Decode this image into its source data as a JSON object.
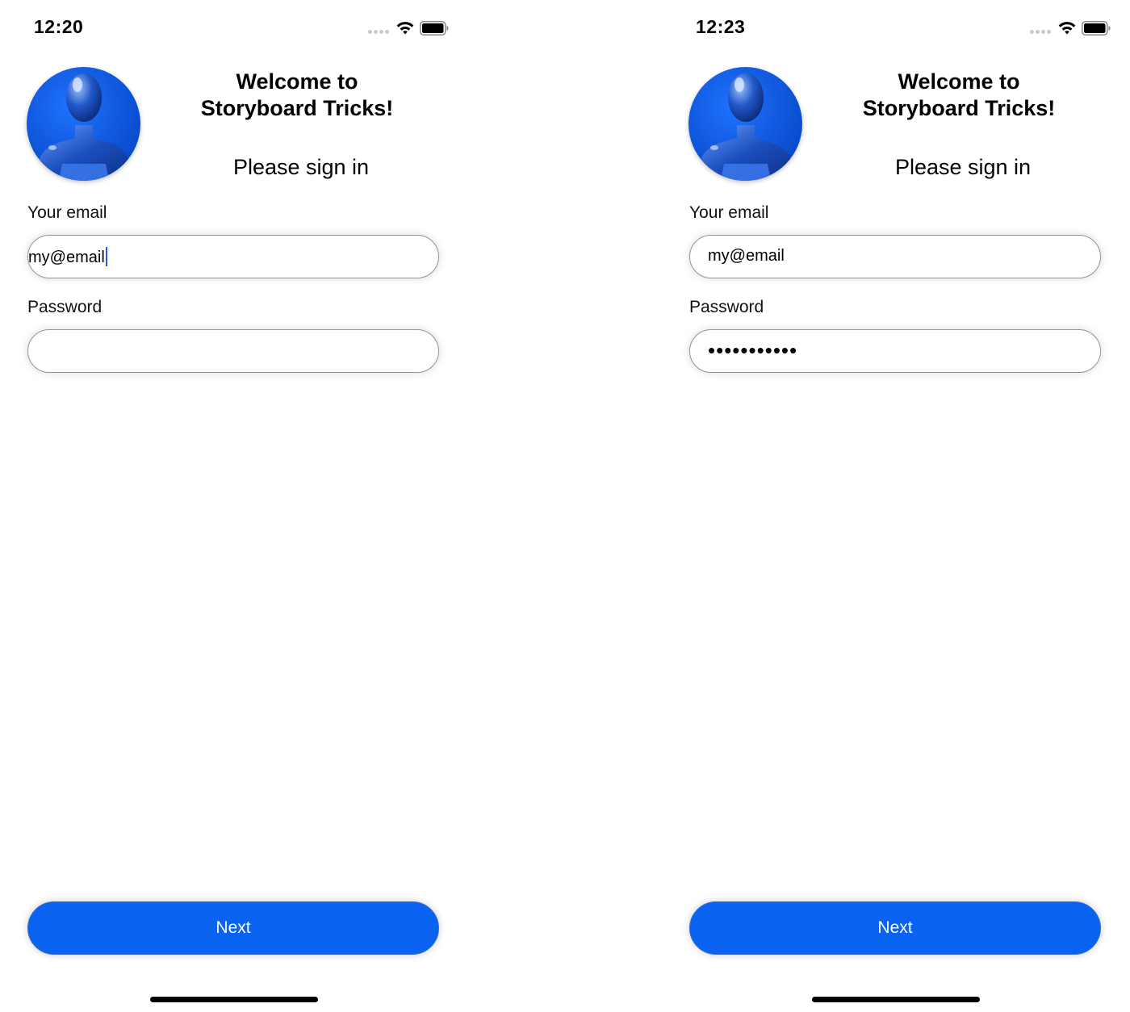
{
  "screens": [
    {
      "id": "left",
      "status_time": "12:20",
      "title_line1": "Welcome to",
      "title_line2": "Storyboard Tricks!",
      "subtitle": "Please sign in",
      "email_label": "Your email",
      "email_value": "my@email",
      "email_focused": true,
      "password_label": "Password",
      "password_value": "",
      "next_label": "Next"
    },
    {
      "id": "right",
      "status_time": "12:23",
      "title_line1": "Welcome to",
      "title_line2": "Storyboard Tricks!",
      "subtitle": "Please sign in",
      "email_label": "Your email",
      "email_value": "my@email",
      "email_focused": false,
      "password_label": "Password",
      "password_value": "•••••••••••",
      "next_label": "Next"
    }
  ],
  "colors": {
    "accent": "#0a62f0",
    "avatar_background": "#0a5ae6",
    "field_border": "#8e96a0"
  },
  "icons": [
    "cellular-signal-icon",
    "wifi-icon",
    "battery-icon",
    "user-avatar-icon"
  ]
}
